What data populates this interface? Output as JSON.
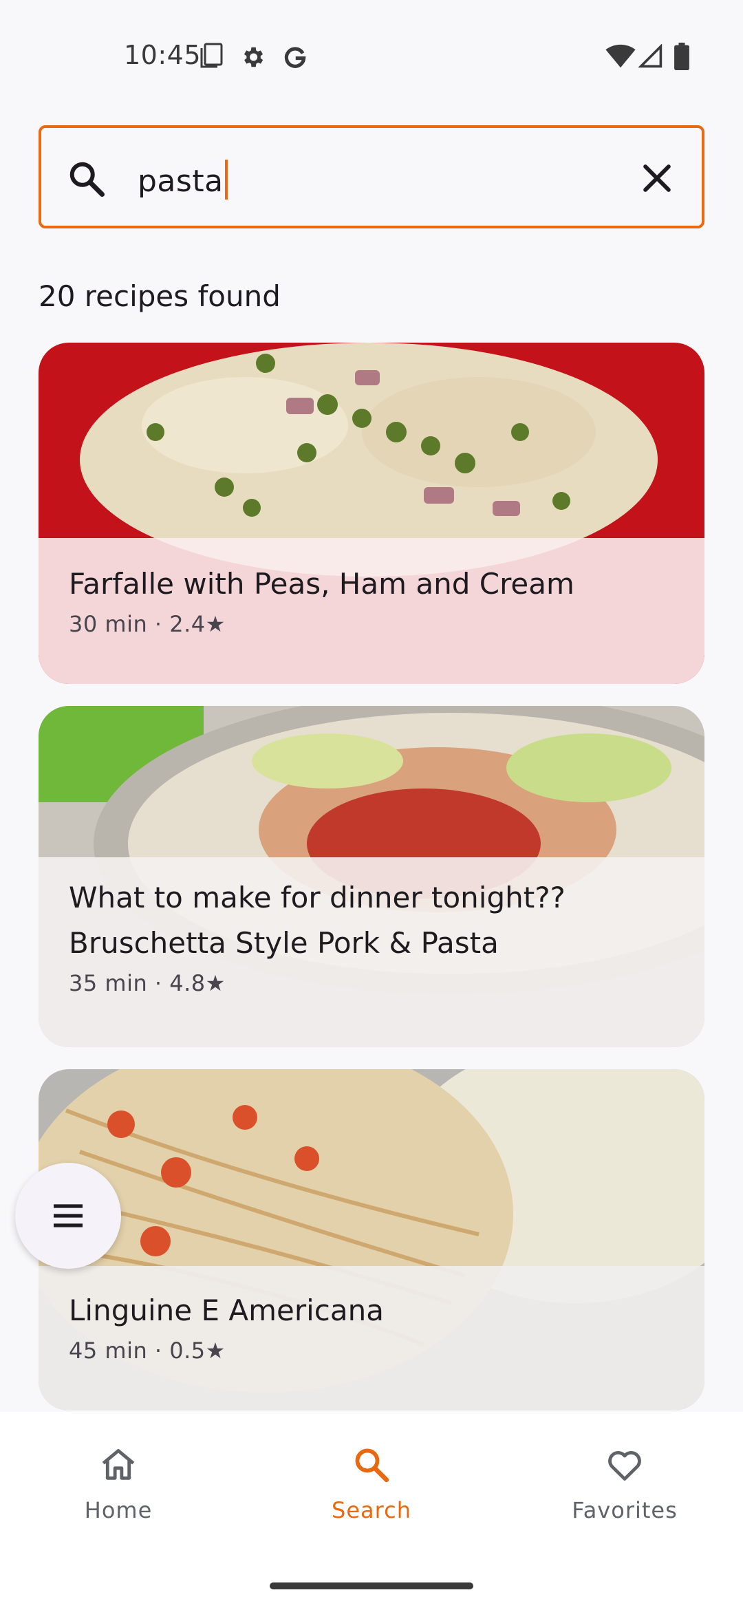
{
  "status_bar": {
    "time": "10:45",
    "icons": [
      "screenshot-icon",
      "gear-icon",
      "google-icon",
      "wifi-icon",
      "signal-icon",
      "battery-icon"
    ]
  },
  "search": {
    "value": "pasta",
    "icon": "search-icon",
    "clear_icon": "close-icon",
    "accent_color": "#ea6a12"
  },
  "results": {
    "count_text": "20 recipes found"
  },
  "recipes": [
    {
      "title": "Farfalle with Peas, Ham and Cream",
      "meta": "30 min · 2.4★"
    },
    {
      "title": "What to make for dinner tonight?? Bruschetta Style Pork & Pasta",
      "meta": "35 min · 4.8★"
    },
    {
      "title": "Linguine E Americana",
      "meta": "45 min · 0.5★"
    }
  ],
  "fab": {
    "icon": "menu-icon"
  },
  "bottom_nav": {
    "items": [
      {
        "label": "Home",
        "icon": "home-icon",
        "active": false
      },
      {
        "label": "Search",
        "icon": "search-icon",
        "active": true
      },
      {
        "label": "Favorites",
        "icon": "heart-icon",
        "active": false
      }
    ],
    "active_color": "#e8690f"
  }
}
